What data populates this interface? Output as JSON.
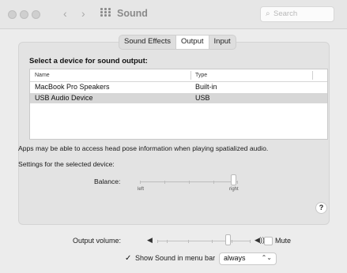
{
  "window": {
    "title": "Sound",
    "search_placeholder": "Search"
  },
  "tabs": [
    {
      "label": "Sound Effects",
      "active": false
    },
    {
      "label": "Output",
      "active": true
    },
    {
      "label": "Input",
      "active": false
    }
  ],
  "output": {
    "heading": "Select a device for sound output:",
    "columns": [
      "Name",
      "Type"
    ],
    "devices": [
      {
        "name": "MacBook Pro Speakers",
        "type": "Built-in",
        "selected": false
      },
      {
        "name": "USB Audio Device",
        "type": "USB",
        "selected": true
      }
    ],
    "info_text": "Apps may be able to access head pose information when playing spatialized audio.",
    "settings_label": "Settings for the selected device:",
    "balance": {
      "label": "Balance:",
      "left_label": "left",
      "right_label": "right",
      "value_fraction": 0.95
    }
  },
  "help_label": "?",
  "volume": {
    "label": "Output volume:",
    "value_fraction": 0.75,
    "mute_label": "Mute",
    "muted": false
  },
  "menubar": {
    "checked": true,
    "check_glyph": "✓",
    "label": "Show Sound in menu bar",
    "select_value": "always",
    "select_arrow": "⌃⌄"
  },
  "icons": {
    "traffic_lights": "traffic-light-icons",
    "back": "‹",
    "forward": "›",
    "search": "⌕",
    "speaker_low": "◀",
    "speaker_high": "◀))"
  },
  "colors": {
    "window_bg": "#ececec",
    "panel_bg": "#e3e3e3",
    "selected_row": "#d7d7d7"
  }
}
